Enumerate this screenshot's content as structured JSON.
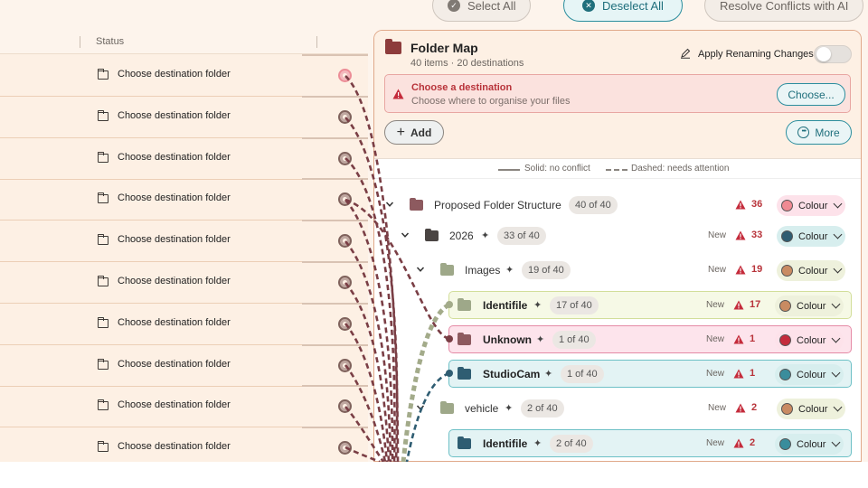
{
  "toolbar": {
    "select_all": "Select All",
    "deselect_all": "Deselect All",
    "resolve_ai": "Resolve Conflicts with AI"
  },
  "table": {
    "status_header": "Status",
    "rows": [
      {
        "status": "Choose destination folder",
        "active": true
      },
      {
        "status": "Choose destination folder",
        "active": false
      },
      {
        "status": "Choose destination folder",
        "active": false
      },
      {
        "status": "Choose destination folder",
        "active": false
      },
      {
        "status": "Choose destination folder",
        "active": false
      },
      {
        "status": "Choose destination folder",
        "active": false
      },
      {
        "status": "Choose destination folder",
        "active": false
      },
      {
        "status": "Choose destination folder",
        "active": false
      },
      {
        "status": "Choose destination folder",
        "active": false
      },
      {
        "status": "Choose destination folder",
        "active": false
      }
    ]
  },
  "folder_map": {
    "title": "Folder Map",
    "subtitle": "40 items · 20 destinations",
    "apply_label": "Apply Renaming Changes",
    "apply_enabled": false,
    "alert": {
      "title": "Choose a destination",
      "message": "Choose where to organise your files",
      "button": "Choose..."
    },
    "add_button": "Add",
    "more_button": "More",
    "legend": {
      "solid": "Solid: no conflict",
      "dashed": "Dashed: needs attention"
    }
  },
  "tree": {
    "colour_label": "Colour",
    "new_label": "New",
    "nodes": [
      {
        "name": "Proposed Folder Structure",
        "count": "40 of 40",
        "warnings": "36",
        "is_new": false,
        "swatch": "#f08a93",
        "folder_color": "#8d5a5f"
      },
      {
        "name": "2026",
        "count": "33 of 40",
        "warnings": "33",
        "is_new": true,
        "swatch": "#2f5d72",
        "folder_color": "#4a4543"
      },
      {
        "name": "Images",
        "count": "19 of 40",
        "warnings": "19",
        "is_new": true,
        "swatch": "#c98b62",
        "folder_color": "#9ea889"
      },
      {
        "name": "Identifile",
        "count": "17 of 40",
        "warnings": "17",
        "is_new": true,
        "swatch": "#c98b62",
        "folder_color": "#9ea889"
      },
      {
        "name": "Unknown",
        "count": "1 of 40",
        "warnings": "1",
        "is_new": true,
        "swatch": "#c42b3b",
        "folder_color": "#8d5a5f"
      },
      {
        "name": "StudioCam",
        "count": "1 of 40",
        "warnings": "1",
        "is_new": true,
        "swatch": "#3a8d9c",
        "folder_color": "#2f5d72"
      },
      {
        "name": "vehicle",
        "count": "2 of 40",
        "warnings": "2",
        "is_new": true,
        "swatch": "#c98b62",
        "folder_color": "#9ea889"
      },
      {
        "name": "Identifile",
        "count": "2 of 40",
        "warnings": "2",
        "is_new": true,
        "swatch": "#3a8d9c",
        "folder_color": "#2f5d72"
      }
    ]
  },
  "colors": {
    "accent": "#1f6f7c",
    "warning": "#b8333a",
    "panel_border": "#e0a98a",
    "connector_red": "#7a3e45",
    "connector_green": "#a3ab8a",
    "connector_teal": "#2f5d72"
  }
}
